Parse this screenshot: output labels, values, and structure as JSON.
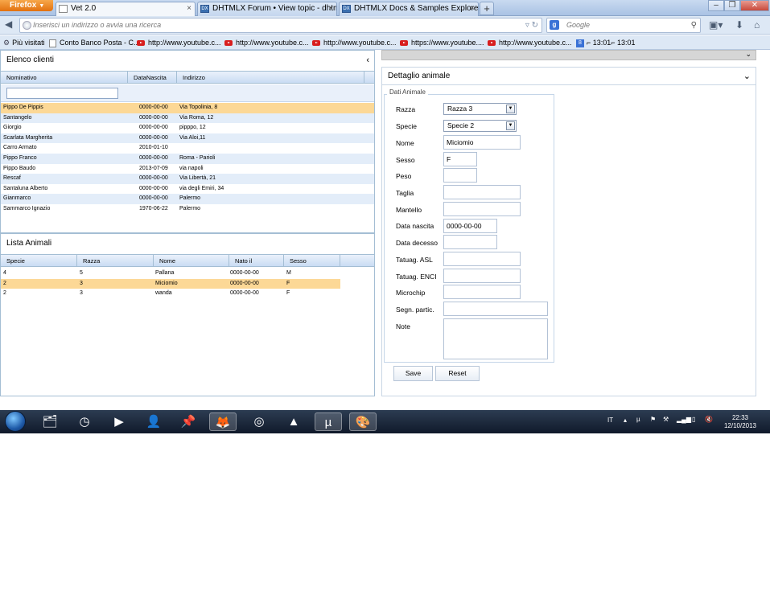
{
  "browser": {
    "menu_label": "Firefox",
    "tabs": [
      {
        "label": "Vet 2.0",
        "close": "×"
      },
      {
        "label": "DHTMLX Forum • View topic - dhtml...",
        "close": "×"
      },
      {
        "label": "DHTMLX Docs & Samples Explorer. D...",
        "close": "×"
      }
    ],
    "new_tab": "+",
    "window_controls": {
      "minimize": "–",
      "maximize": "❐",
      "close": "✕"
    },
    "url_placeholder": "Inserisci un indirizzo o avvia una ricerca",
    "search_engine": "Google",
    "bookmarks": [
      {
        "label": "Più visitati",
        "icon": "gear-icon"
      },
      {
        "label": "Conto Banco Posta - C...",
        "icon": "page-icon"
      },
      {
        "label": "http://www.youtube.c...",
        "icon": "youtube-icon"
      },
      {
        "label": "http://www.youtube.c...",
        "icon": "youtube-icon"
      },
      {
        "label": "http://www.youtube.c...",
        "icon": "youtube-icon"
      },
      {
        "label": "https://www.youtube....",
        "icon": "youtube-icon"
      },
      {
        "label": "http://www.youtube.c...",
        "icon": "youtube-icon"
      },
      {
        "label": "⌐ 13:01⌐ 13:01",
        "icon": "google-icon"
      }
    ]
  },
  "clients_panel": {
    "title": "Elenco clienti",
    "columns": [
      "Nominativo",
      "DataNascita",
      "Indirizzo"
    ],
    "rows": [
      {
        "name": "Pippo De Pippis",
        "dob": "0000-00-00",
        "address": "Via Topolinia, 8"
      },
      {
        "name": "Santangelo",
        "dob": "0000-00-00",
        "address": "Via Roma, 12"
      },
      {
        "name": "Giorgio",
        "dob": "0000-00-00",
        "address": "pipppo, 12"
      },
      {
        "name": "Scarlata Margherita",
        "dob": "0000-00-00",
        "address": "Via Aloi,11"
      },
      {
        "name": "Carro Armato",
        "dob": "2010-01-10",
        "address": ""
      },
      {
        "name": "Pippo Franco",
        "dob": "0000-00-00",
        "address": "Roma - Parioli"
      },
      {
        "name": "Pippo Baudo",
        "dob": "2013-07-09",
        "address": "via napoli"
      },
      {
        "name": "Rescaf",
        "dob": "0000-00-00",
        "address": "Via Libertà, 21"
      },
      {
        "name": "Santaluna Alberto",
        "dob": "0000-00-00",
        "address": "via degli Emiri, 34"
      },
      {
        "name": "Gianmarco",
        "dob": "0000-00-00",
        "address": "Palermo"
      },
      {
        "name": "Sammarco Ignazio",
        "dob": "1970-06-22",
        "address": "Palermo"
      }
    ],
    "selected_index": 0
  },
  "animals_panel": {
    "title": "Lista Animali",
    "columns": [
      "Specie",
      "Razza",
      "Nome",
      "Nato il",
      "Sesso"
    ],
    "rows": [
      {
        "specie": "4",
        "razza": "5",
        "nome": "Pallana",
        "nato": "0000-00-00",
        "sesso": "M"
      },
      {
        "specie": "2",
        "razza": "3",
        "nome": "Miciomio",
        "nato": "0000-00-00",
        "sesso": "F"
      },
      {
        "specie": "2",
        "razza": "3",
        "nome": "wanda",
        "nato": "0000-00-00",
        "sesso": "F"
      }
    ],
    "selected_index": 1
  },
  "detail_panel": {
    "title": "Dettaglio animale",
    "legend": "Dati Animale",
    "fields": {
      "razza": {
        "label": "Razza",
        "value": "Razza 3"
      },
      "specie": {
        "label": "Specie",
        "value": "Specie 2"
      },
      "nome": {
        "label": "Nome",
        "value": "Miciomio"
      },
      "sesso": {
        "label": "Sesso",
        "value": "F"
      },
      "peso": {
        "label": "Peso",
        "value": ""
      },
      "taglia": {
        "label": "Taglia",
        "value": ""
      },
      "mantello": {
        "label": "Mantello",
        "value": ""
      },
      "data_nascita": {
        "label": "Data nascita",
        "value": "0000-00-00"
      },
      "data_decesso": {
        "label": "Data decesso",
        "value": ""
      },
      "tatuag_asl": {
        "label": "Tatuag. ASL",
        "value": ""
      },
      "tatuag_enci": {
        "label": "Tatuag. ENCI",
        "value": ""
      },
      "microchip": {
        "label": "Microchip",
        "value": ""
      },
      "segn_partic": {
        "label": "Segn. partic.",
        "value": ""
      },
      "note": {
        "label": "Note",
        "value": ""
      }
    },
    "save_label": "Save",
    "reset_label": "Reset"
  },
  "taskbar": {
    "language": "IT",
    "time": "22:33",
    "date": "12/10/2013"
  },
  "colors": {
    "selected_row": "#fcd896",
    "alt_row": "#e3edf9",
    "panel_border": "#a4bed4"
  }
}
